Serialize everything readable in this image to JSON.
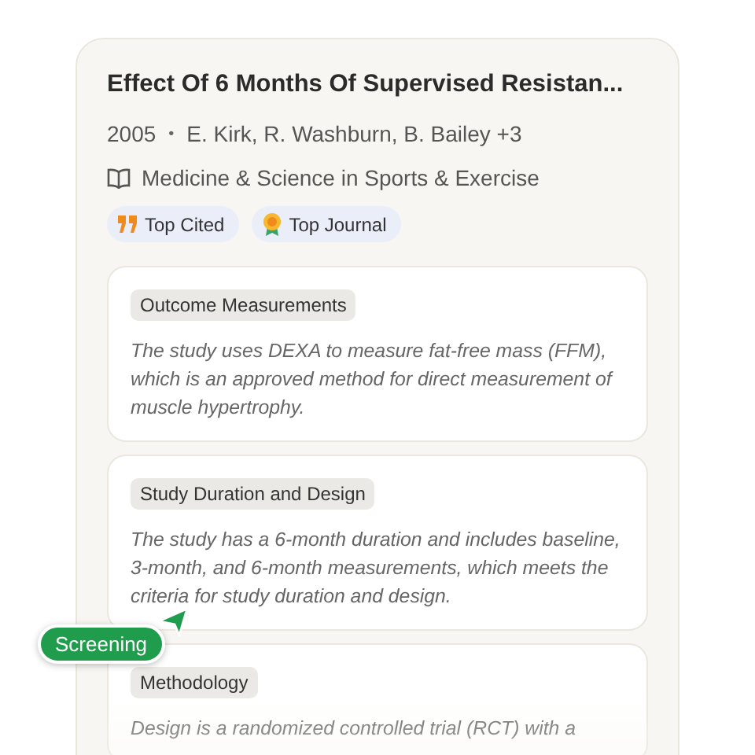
{
  "paper": {
    "title": "Effect Of 6 Months Of Supervised Resistan...",
    "year": "2005",
    "separator": "•",
    "authors": "E. Kirk, R. Washburn, B. Bailey +3",
    "journal": "Medicine & Science in Sports & Exercise",
    "badges": [
      {
        "label": "Top Cited",
        "kind": "cited"
      },
      {
        "label": "Top Journal",
        "kind": "journal"
      }
    ]
  },
  "criteria": [
    {
      "heading": "Outcome Measurements",
      "text": "The study uses DEXA to measure fat-free mass (FFM), which is an approved method for direct measurement of muscle hypertrophy."
    },
    {
      "heading": "Study Duration and Design",
      "text": "The study has a 6-month duration and includes baseline, 3-month, and 6-month measurements, which meets the criteria for study duration and design."
    },
    {
      "heading": "Methodology",
      "text": "Design is a randomized controlled trial (RCT) with a"
    }
  ],
  "cursor": {
    "label": "Screening"
  }
}
